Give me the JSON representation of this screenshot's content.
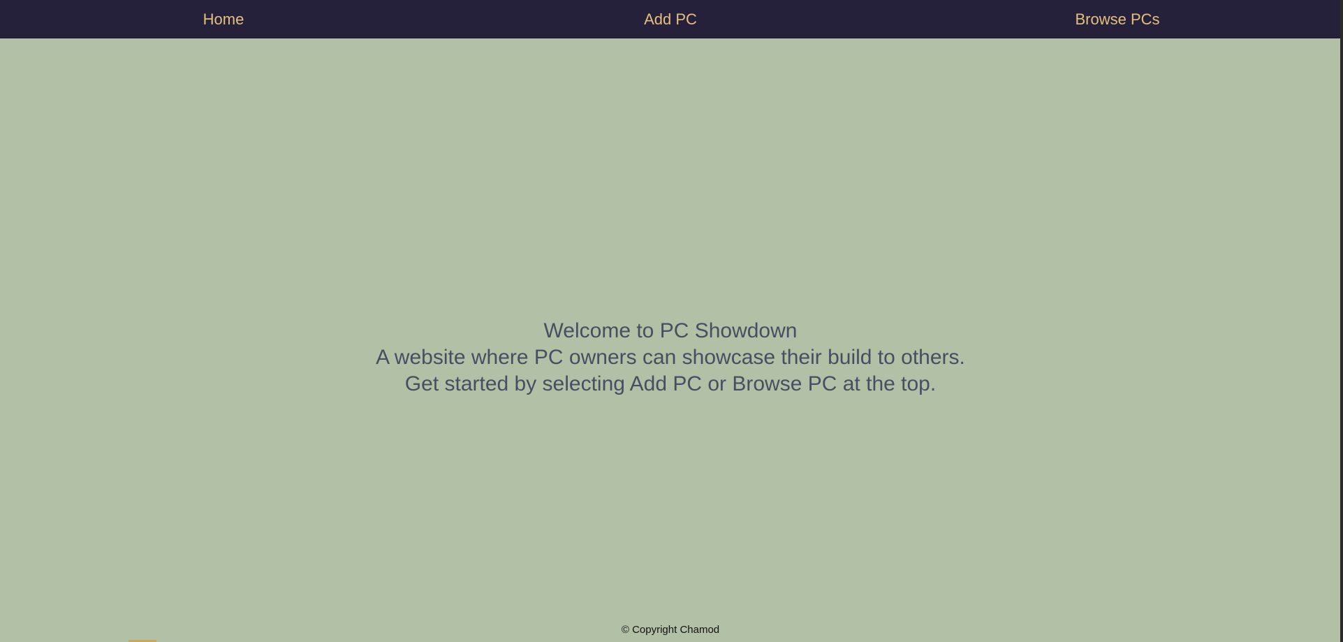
{
  "nav": {
    "home": "Home",
    "add_pc": "Add PC",
    "browse_pcs": "Browse PCs"
  },
  "hero": {
    "title": "Welcome to PC Showdown",
    "line1": "A website where PC owners can showcase their build to others.",
    "line2": "Get started by selecting Add PC or Browse PC at the top."
  },
  "footer": {
    "copyright": "© Copyright Chamod"
  },
  "colors": {
    "navbar_bg": "#25213a",
    "nav_text": "#e3c07e",
    "page_bg": "#b2c0a6",
    "hero_text": "#484e62"
  }
}
